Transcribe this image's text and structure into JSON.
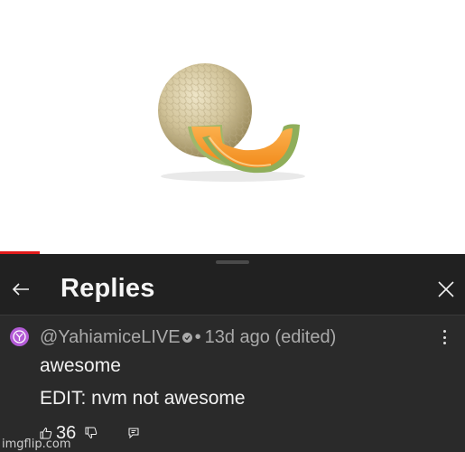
{
  "replies_panel": {
    "title": "Replies",
    "back_icon": "arrow-left-icon",
    "close_icon": "close-icon"
  },
  "comment": {
    "author": "@YahiamiceLIVE",
    "separator": "•",
    "time": "13d ago (edited)",
    "line1": "awesome",
    "line2": "EDIT: nvm not awesome",
    "like_count": "36"
  },
  "watermark": "imgflip.com",
  "colors": {
    "panel_bg": "#212121",
    "comment_bg": "#2a2a2a",
    "progress": "#e21b1b",
    "avatar": "#b35bd6"
  }
}
